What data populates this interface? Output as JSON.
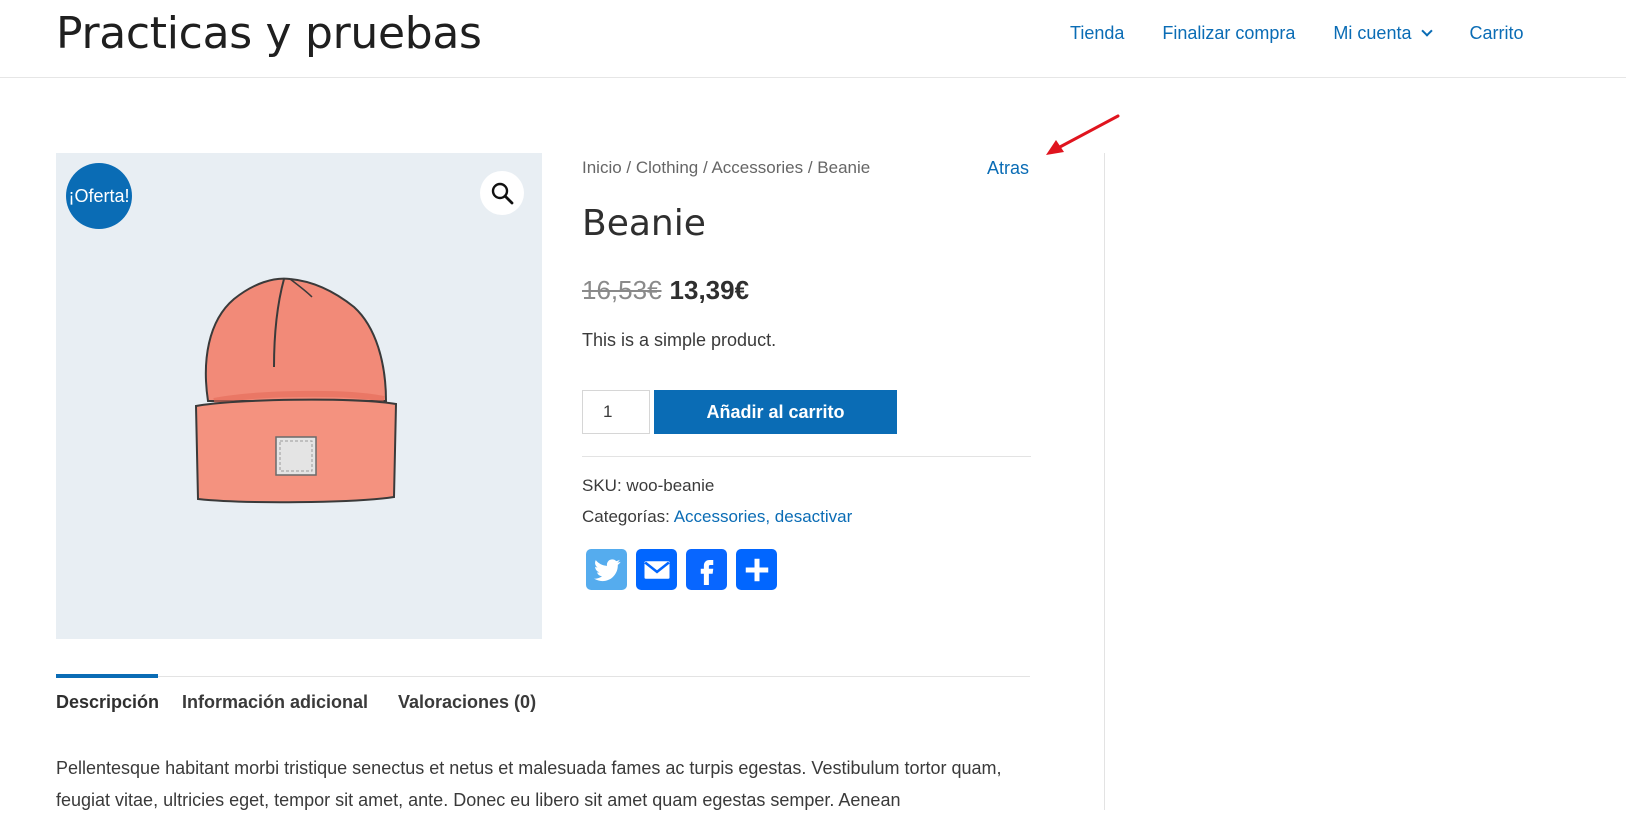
{
  "header": {
    "site_title": "Practicas y pruebas",
    "nav": [
      "Tienda",
      "Finalizar compra",
      "Mi cuenta",
      "Carrito"
    ]
  },
  "gallery": {
    "sale_badge": "¡Oferta!",
    "zoom_icon": "magnifier-icon",
    "image": "beanie-product-image"
  },
  "summary": {
    "breadcrumb": "Inicio / Clothing / Accessories / Beanie",
    "back_link": "Atras",
    "title": "Beanie",
    "price_old": "16,53€",
    "price_new": "13,39€",
    "short_description": "This is a simple product.",
    "quantity_value": "1",
    "add_to_cart": "Añadir al carrito",
    "sku_label": "SKU:",
    "sku_value": "woo-beanie",
    "categories_label": "Categorías:",
    "category_1": "Accessories,",
    "category_2": "desactivar",
    "share": [
      "twitter-icon",
      "email-icon",
      "facebook-icon",
      "share-plus-icon"
    ]
  },
  "tabs": [
    {
      "label": "Descripción",
      "active": true
    },
    {
      "label": "Información adicional",
      "active": false
    },
    {
      "label": "Valoraciones (0)",
      "active": false
    }
  ],
  "description": "Pellentesque habitant morbi tristique senectus et netus et malesuada fames ac turpis egestas. Vestibulum tortor quam, feugiat vitae, ultricies eget, tempor sit amet, ante. Donec eu libero sit amet quam egestas semper. Aenean",
  "colors": {
    "accent": "#0a6cb5",
    "annotation": "#e0141e"
  }
}
